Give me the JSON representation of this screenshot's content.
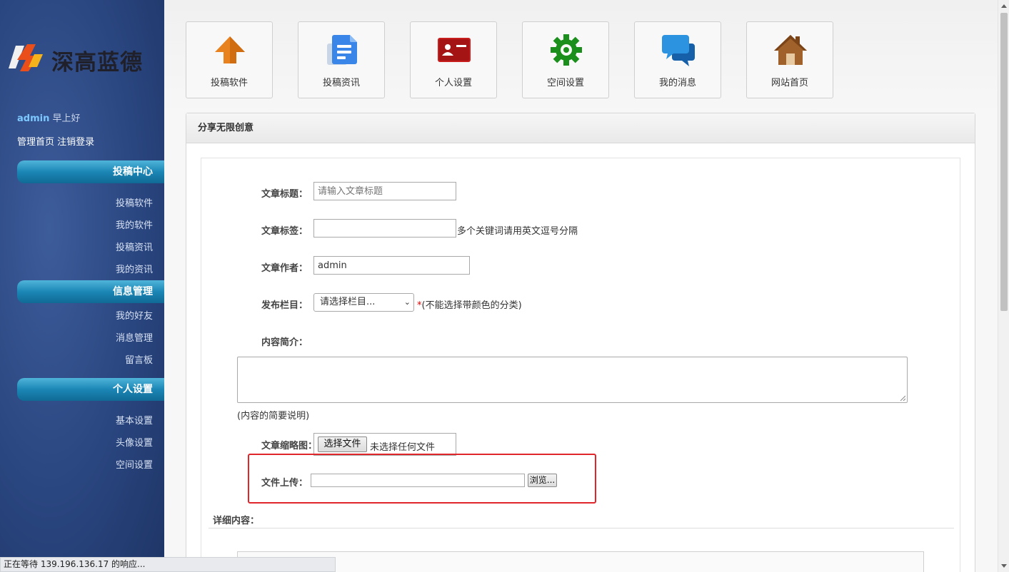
{
  "sidebar": {
    "logo_text": "深高蓝德",
    "user_name": "admin",
    "greeting": "早上好",
    "link_home": "管理首页",
    "link_logout": "注销登录",
    "sections": [
      {
        "title": "投稿中心",
        "items": [
          "投稿软件",
          "我的软件",
          "投稿资讯",
          "我的资讯"
        ]
      },
      {
        "title": "信息管理",
        "items": [
          "我的好友",
          "消息管理",
          "留言板"
        ]
      },
      {
        "title": "个人设置",
        "items": [
          "基本设置",
          "头像设置",
          "空间设置"
        ]
      }
    ]
  },
  "tiles": [
    {
      "label": "投稿软件",
      "icon": "up-arrow-icon",
      "color": "#e8821e"
    },
    {
      "label": "投稿资讯",
      "icon": "document-icon",
      "color": "#3a86e8"
    },
    {
      "label": "个人设置",
      "icon": "id-card-icon",
      "color": "#c81e1e"
    },
    {
      "label": "空间设置",
      "icon": "gear-icon",
      "color": "#1b8f1b"
    },
    {
      "label": "我的消息",
      "icon": "chat-bubble-icon",
      "color": "#1f86d6"
    },
    {
      "label": "网站首页",
      "icon": "home-icon",
      "color": "#a0612b"
    }
  ],
  "panel": {
    "title": "分享无限创意"
  },
  "form": {
    "title_label": "文章标题：",
    "title_placeholder": "请输入文章标题",
    "tags_label": "文章标签：",
    "tags_value": "",
    "tags_hint": "多个关键词请用英文逗号分隔",
    "author_label": "文章作者：",
    "author_value": "admin",
    "category_label": "发布栏目：",
    "category_selected": "请选择栏目...",
    "category_required": "*",
    "category_hint": "(不能选择带颜色的分类)",
    "summary_label": "内容简介：",
    "summary_hint": "(内容的简要说明)",
    "thumb_label": "文章缩略图：",
    "thumb_button": "选择文件",
    "thumb_status": "未选择任何文件",
    "upload_label": "文件上传：",
    "upload_value": "",
    "browse_button": "浏览...",
    "detail_label": "详细内容："
  },
  "statusbar": {
    "text": "正在等待 139.196.136.17 的响应..."
  },
  "colors": {
    "sidebar_bg": "#2a4680",
    "section_head": "#1b86b5",
    "highlight": "#e0262b"
  }
}
